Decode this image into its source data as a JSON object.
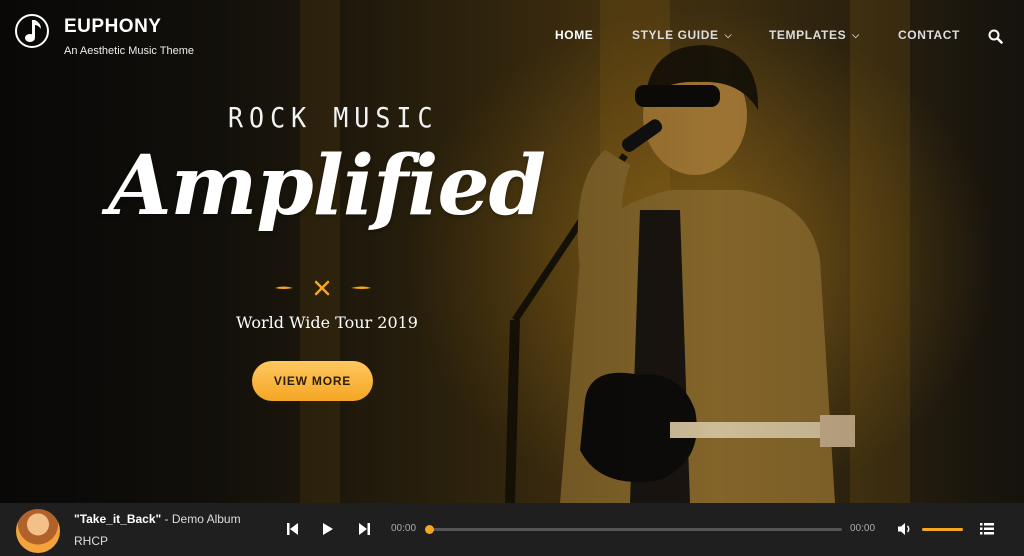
{
  "header": {
    "brand": "EUPHONY",
    "tagline": "An Aesthetic Music Theme",
    "nav": [
      {
        "label": "HOME",
        "active": true,
        "dropdown": false
      },
      {
        "label": "STYLE GUIDE",
        "active": false,
        "dropdown": true
      },
      {
        "label": "TEMPLATES",
        "active": false,
        "dropdown": true
      },
      {
        "label": "CONTACT",
        "active": false,
        "dropdown": false
      }
    ],
    "icons": {
      "logo": "music-note-icon",
      "search": "search-icon"
    }
  },
  "hero": {
    "eyebrow": "ROCK MUSIC",
    "headline": "Amplified",
    "subtitle": "World Wide Tour 2019",
    "cta": "VIEW MORE",
    "image": "guitarist-singing-at-microphone"
  },
  "player": {
    "song": "\"Take_it_Back\"",
    "album": " - Demo Album",
    "artist": "RHCP",
    "time_elapsed": "00:00",
    "time_total": "00:00",
    "progress": 0,
    "volume": 1.0,
    "icons": [
      "previous-icon",
      "play-icon",
      "next-icon",
      "volume-icon",
      "playlist-icon"
    ]
  },
  "colors": {
    "accent": "#f5a623",
    "player_bg": "#1f1f1f"
  }
}
